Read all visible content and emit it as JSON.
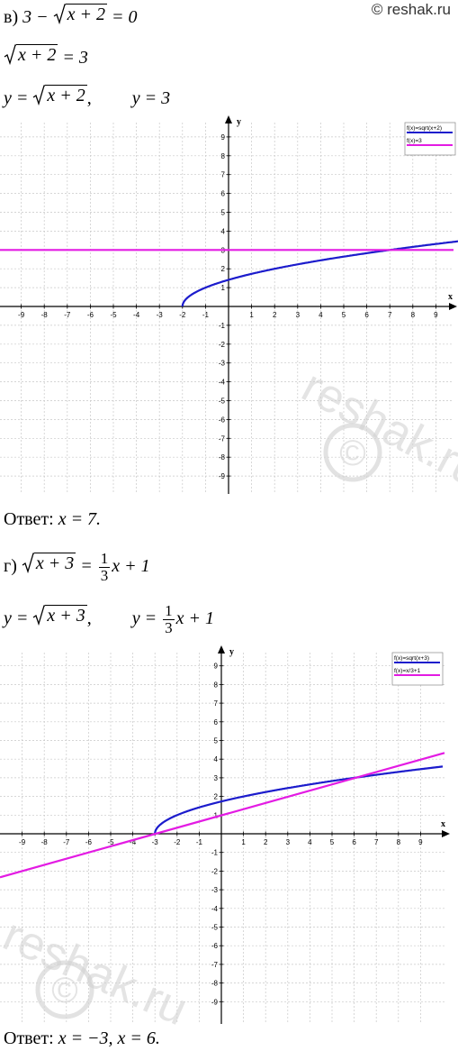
{
  "copyright": "© reshak.ru",
  "part_v": {
    "letter": "в)",
    "eq1_left": "3 − ",
    "eq1_rad": "x + 2",
    "eq1_right": " = 0",
    "eq2_rad": "x + 2",
    "eq2_right": " = 3",
    "eq3_y1": "y = ",
    "eq3_rad": "x + 2",
    "eq3_comma": ",",
    "eq3_y2": "y = 3",
    "answer_label": "Ответ: ",
    "answer_value": "x = 7."
  },
  "part_g": {
    "letter": "г)",
    "eq1_rad": "x + 3",
    "eq1_eq": " = ",
    "eq1_num": "1",
    "eq1_den": "3",
    "eq1_tail": "x + 1",
    "eq2_y1": "y = ",
    "eq2_rad": "x + 3",
    "eq2_comma": ",",
    "eq2_y2": "y = ",
    "eq2_num": "1",
    "eq2_den": "3",
    "eq2_tail": "x + 1",
    "answer_label": "Ответ: ",
    "answer_value": "x = −3, x = 6."
  },
  "chart_data": [
    {
      "type": "line",
      "xlabel": "x",
      "ylabel": "y",
      "xlim": [
        -10,
        10
      ],
      "ylim": [
        -10,
        10
      ],
      "x_ticks": [
        "-9",
        "-8",
        "-7",
        "-6",
        "-5",
        "-4",
        "-3",
        "-2",
        "-1",
        "1",
        "2",
        "3",
        "4",
        "5",
        "6",
        "7",
        "8",
        "9"
      ],
      "y_ticks": [
        "9",
        "8",
        "7",
        "6",
        "5",
        "4",
        "3",
        "2",
        "1",
        "-1",
        "-2",
        "-3",
        "-4",
        "-5",
        "-6",
        "-7",
        "-8",
        "-9"
      ],
      "grid": true,
      "legend_position": "top-right",
      "series": [
        {
          "name": "f(x)=sqrt(x+2)",
          "color": "#1c1ccc",
          "fn": "sqrt_shift",
          "shift": 2
        },
        {
          "name": "f(x)=3",
          "color": "#e31be3",
          "fn": "const",
          "value": 3
        }
      ]
    },
    {
      "type": "line",
      "xlabel": "x",
      "ylabel": "y",
      "xlim": [
        -10,
        10
      ],
      "ylim": [
        -10,
        10
      ],
      "x_ticks": [
        "-9",
        "-8",
        "-7",
        "-6",
        "-5",
        "-4",
        "-3",
        "-2",
        "-1",
        "1",
        "2",
        "3",
        "4",
        "5",
        "6",
        "7",
        "8",
        "9"
      ],
      "y_ticks": [
        "9",
        "8",
        "7",
        "6",
        "5",
        "4",
        "3",
        "2",
        "1",
        "-1",
        "-2",
        "-3",
        "-4",
        "-5",
        "-6",
        "-7",
        "-8",
        "-9"
      ],
      "grid": true,
      "legend_position": "top-right",
      "series": [
        {
          "name": "f(x)=sqrt(x+3)",
          "color": "#1c1ccc",
          "fn": "sqrt_shift",
          "shift": 3
        },
        {
          "name": "f(x)=x/3+1",
          "color": "#e31be3",
          "fn": "linear",
          "slope": 0.3333,
          "intercept": 1
        }
      ]
    }
  ],
  "watermark": {
    "text": "reshak.ru",
    "symbol": "©"
  }
}
